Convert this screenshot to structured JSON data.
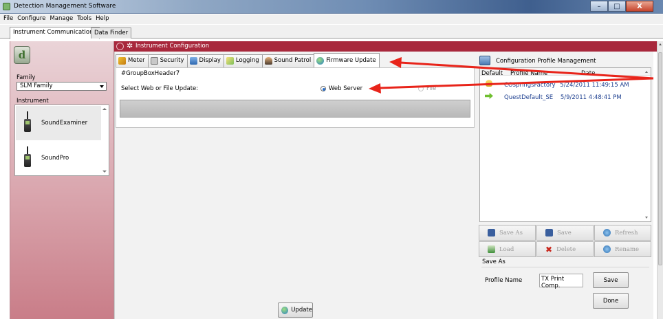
{
  "window": {
    "title": "Detection Management Software",
    "minimize": "–",
    "maximize": "□",
    "close": "X"
  },
  "menu": [
    "File",
    "Configure",
    "Manage",
    "Tools",
    "Help"
  ],
  "top_tabs": [
    "Instrument Communications",
    "Data Finder"
  ],
  "left": {
    "logo_letter": "d",
    "family_label": "Family",
    "family_value": "SLM Family",
    "instrument_label": "Instrument",
    "instruments": [
      "SoundExaminer",
      "SoundPro"
    ]
  },
  "config": {
    "title": "Instrument Configuration",
    "tabs": [
      "Meter",
      "Security",
      "Display",
      "Logging",
      "Sound Patrol",
      "Firmware Update"
    ],
    "active_tab": "Firmware Update",
    "group_header": "#GroupBoxHeader7",
    "select_label": "Select Web or File Update:",
    "radio_web": "Web Server",
    "radio_file": "File",
    "selected_option": "Web Server",
    "update_button": "Update"
  },
  "profiles": {
    "title": "Configuration Profile Management",
    "columns": [
      "Default",
      "Profile Name",
      "Date"
    ],
    "rows": [
      {
        "name": "COspringsFactory",
        "date": "5/24/2011 11:49:15 AM"
      },
      {
        "name": "QuestDefault_SE",
        "date": "5/9/2011 4:48:41 PM"
      }
    ],
    "buttons": [
      "Save As",
      "Save",
      "Refresh",
      "Load",
      "Delete",
      "Rename"
    ],
    "save_as_label": "Save As",
    "profile_name_label": "Profile Name",
    "profile_name_value": "TX Print Comp.",
    "save_button": "Save",
    "done_button": "Done"
  },
  "colors": {
    "header_red": "#a8283c",
    "annotation_red": "#e8241a",
    "left_panel": "#d9a5ad"
  }
}
